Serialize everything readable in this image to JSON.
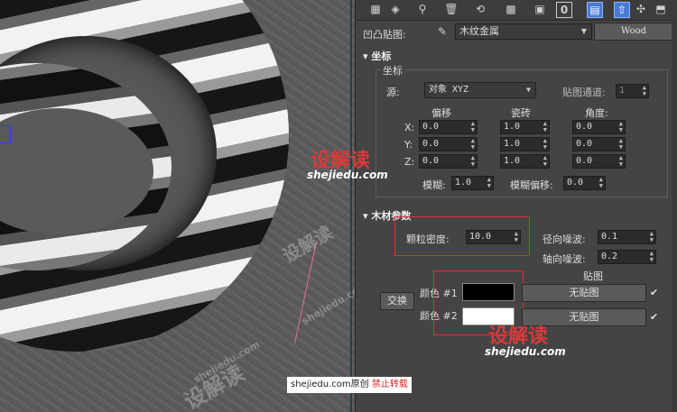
{
  "viewport": {
    "watermarks": [
      "设解读",
      "shejiedu.com",
      "设解读",
      "shejiedu.com"
    ]
  },
  "toolbar": {
    "icons": [
      "material-icon",
      "assign-icon",
      "pick-icon",
      "delete-icon",
      "reset-icon",
      "map-icon",
      "save-icon",
      "channel-icon",
      "show-map-icon",
      "show-end-icon",
      "navigate-icon",
      "go-parent-icon"
    ],
    "channel_label": "0"
  },
  "bump_map": {
    "label": "凹凸贴图:",
    "map_name": "木纹金属",
    "map_type_button": "Wood"
  },
  "coordinates": {
    "rollout_title": "坐标",
    "group_title": "坐标",
    "source_label": "源:",
    "source_value": "对象 XYZ",
    "map_channel_label": "贴图通道:",
    "map_channel_value": "1",
    "offset_label": "偏移",
    "tiling_label": "瓷砖",
    "angle_label": "角度:",
    "axis_x": "X:",
    "axis_y": "Y:",
    "axis_z": "Z:",
    "offset_x": "0.0",
    "offset_y": "0.0",
    "offset_z": "0.0",
    "tiling_x": "1.0",
    "tiling_y": "1.0",
    "tiling_z": "1.0",
    "angle_x": "0.0",
    "angle_y": "0.0",
    "angle_z": "0.0",
    "blur_label": "模糊:",
    "blur_value": "1.0",
    "blur_offset_label": "模糊偏移:",
    "blur_offset_value": "0.0"
  },
  "wood_params": {
    "rollout_title": "木材参数",
    "grain_density_label": "颗粒密度:",
    "grain_density_value": "10.0",
    "radial_noise_label": "径向噪波:",
    "radial_noise_value": "0.1",
    "axial_noise_label": "轴向噪波:",
    "axial_noise_value": "0.2",
    "maps_label": "贴图",
    "swap_button": "交换",
    "color1_label": "颜色 #1",
    "color2_label": "颜色 #2",
    "color1": "#000000",
    "color2": "#ffffff",
    "map1_button": "无贴图",
    "map2_button": "无贴图",
    "map1_enabled": true,
    "map2_enabled": true
  },
  "watermark": {
    "logo_top": "设解读",
    "url_top": "shejiedu.com",
    "logo_bottom": "设解读",
    "url_bottom": "shejiedu.com"
  },
  "footer": {
    "site": "shejiedu.com原创",
    "notice": "禁止转载"
  }
}
